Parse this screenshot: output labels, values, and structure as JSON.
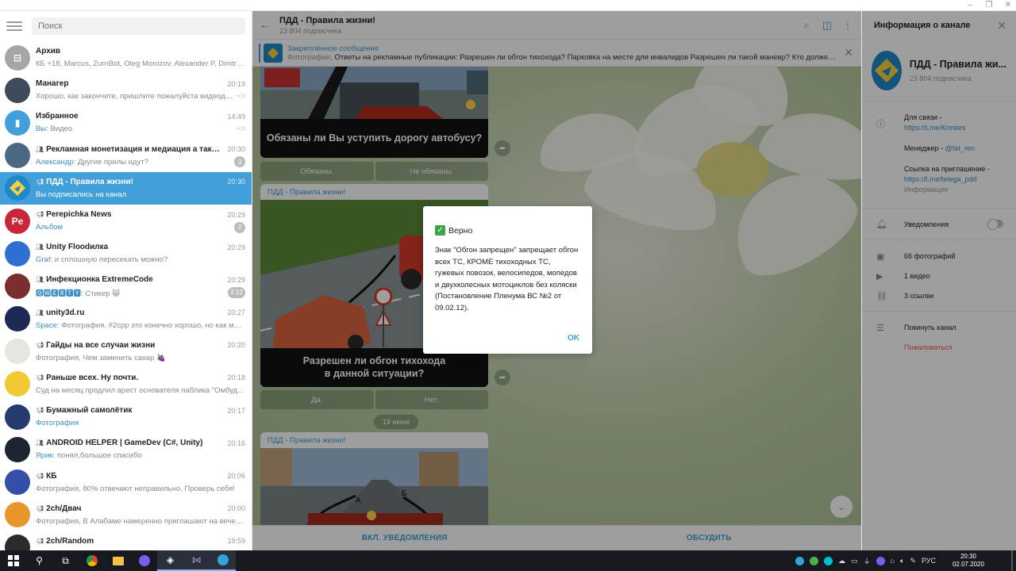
{
  "window": {
    "minimize": "–",
    "maximize": "❐",
    "close": "✕"
  },
  "search": {
    "placeholder": "Поиск"
  },
  "chats": [
    {
      "title": "Архив",
      "time": "",
      "preview_prefix": "",
      "preview": "КБ +18, Marcus, ZurnBot, Oleg Morozov, Alexander P, Dmitry Pogr...",
      "badge": "",
      "pinned": false,
      "type": "",
      "avatar_color": "#a6a6a6",
      "avatar_text": "⊟"
    },
    {
      "title": "Манагер",
      "time": "20:19",
      "preview_prefix": "",
      "preview": "Хорошо, как закончите, пришлите пожалуйста видеодем...",
      "badge": "",
      "pinned": true,
      "type": "",
      "avatar_color": "#3f4a5a",
      "avatar_text": ""
    },
    {
      "title": "Избранное",
      "time": "14:49",
      "preview_prefix": "Вы: ",
      "preview": "Видео",
      "badge": "",
      "pinned": true,
      "type": "",
      "avatar_color": "#419fd9",
      "avatar_text": "▮"
    },
    {
      "title": "Рекламная монетизация и медиация а также UA (...",
      "time": "20:30",
      "preview_prefix": "Александр: ",
      "preview": "Другие прилы идут?",
      "badge": "3",
      "pinned": false,
      "type": "group",
      "avatar_color": "#4c6782",
      "avatar_text": ""
    },
    {
      "title": "ПДД - Правила жизни!",
      "time": "20:30",
      "preview_prefix": "",
      "preview": "Вы подписались на канал",
      "badge": "",
      "pinned": false,
      "type": "channel",
      "avatar_color": "#1e88c9",
      "avatar_text": "",
      "active": true
    },
    {
      "title": "Perepichka News",
      "time": "20:29",
      "preview_prefix": "",
      "preview": "Альбом",
      "preview_link": true,
      "badge": "2",
      "pinned": false,
      "type": "channel",
      "avatar_color": "#c8273a",
      "avatar_text": "Pe"
    },
    {
      "title": "Unity Floodилка",
      "time": "20:29",
      "preview_prefix": "Graf: ",
      "preview": "и сплошную пересекать можно?",
      "badge": "",
      "pinned": false,
      "type": "group",
      "avatar_color": "#2f6fd1",
      "avatar_text": ""
    },
    {
      "title": "Инфекционка ExtremeCode",
      "time": "20:29",
      "preview_prefix": "🆀🆆🅴🆁🆃🆈: ",
      "preview": "Стикер 😸",
      "badge": "2.12",
      "pinned": false,
      "type": "group",
      "avatar_color": "#7b2e2e",
      "avatar_text": ""
    },
    {
      "title": "unity3d.ru",
      "time": "20:27",
      "preview_prefix": "Space: ",
      "preview": "Фотография, #2срр это конечно хорошо, но как мне те...",
      "badge": "",
      "pinned": false,
      "type": "group",
      "avatar_color": "#1b2a55",
      "avatar_text": ""
    },
    {
      "title": "Гайды на все случаи жизни",
      "time": "20:20",
      "preview_prefix": "",
      "preview": "Фотография, Чем заменить сахар 🍇",
      "badge": "",
      "pinned": false,
      "type": "channel",
      "avatar_color": "#e8e4e0",
      "avatar_text": ""
    },
    {
      "title": "Раньше всех. Ну почти.",
      "time": "20:18",
      "preview_prefix": "",
      "preview": "Суд на месяц продлил арест основателя паблика \"Омбудсмен ...",
      "badge": "",
      "pinned": false,
      "type": "channel",
      "avatar_color": "#f2c933",
      "avatar_text": ""
    },
    {
      "title": "Бумажный самолётик",
      "time": "20:17",
      "preview_prefix": "",
      "preview": "Фотография",
      "preview_link": true,
      "badge": "",
      "pinned": false,
      "type": "channel",
      "avatar_color": "#253a6e",
      "avatar_text": ""
    },
    {
      "title": "ANDROID HELPER | GameDev (C#, Unity)",
      "time": "20:16",
      "preview_prefix": "Ярик: ",
      "preview": "понял,большое спасибо",
      "badge": "",
      "pinned": false,
      "type": "group",
      "avatar_color": "#1d2630",
      "avatar_text": ""
    },
    {
      "title": "КБ",
      "time": "20:06",
      "preview_prefix": "",
      "preview": "Фотография, 80% отвечают неправильно. Проверь себя!",
      "badge": "",
      "pinned": false,
      "type": "channel",
      "avatar_color": "#3350a8",
      "avatar_text": ""
    },
    {
      "title": "2ch/Двач",
      "time": "20:00",
      "preview_prefix": "",
      "preview": "Фотография, В Алабаме намеренно приглашают на вечеринк...",
      "badge": "",
      "pinned": false,
      "type": "channel",
      "avatar_color": "#e8952a",
      "avatar_text": ""
    },
    {
      "title": "2ch/Random",
      "time": "19:59",
      "preview_prefix": "",
      "preview": "",
      "badge": "",
      "pinned": false,
      "type": "channel",
      "avatar_color": "#2b2b2b",
      "avatar_text": ""
    }
  ],
  "chat_header": {
    "title": "ПДД - Правила жизни!",
    "subtitle": "23 804 подписчика"
  },
  "pinned": {
    "label": "Закреплённое сообщение",
    "kind": "Фотография, ",
    "text": "Ответы на рекламные публикации:  Разрешен ли обгон тихохода?  Парковка на месте для инвалидов  Разрешен ли такой маневр?  Кто должен уступ..."
  },
  "messages": {
    "m1_caption": "Обязаны ли Вы уступить дорогу автобусу?",
    "m1_answers": [
      "Обязаны.",
      "Не обязаны."
    ],
    "m2_from": "ПДД - Правила жизни!",
    "m2_caption_l1": "Разрешен ли обгон тихохода",
    "m2_caption_l2": "в данной ситуации?",
    "m2_answers": [
      "Да.",
      "Нет."
    ],
    "date": "19 июня",
    "m3_from": "ПДД - Правила жизни!",
    "m3_labels": [
      "А",
      "Б"
    ]
  },
  "footer": {
    "left": "ВКЛ. УВЕДОМЛЕНИЯ",
    "right": "ОБСУДИТЬ"
  },
  "modal": {
    "title": "Верно",
    "text": "Знак \"Обгон запрещен\" запрещает обгон всех ТС, КРОМЕ тихоходных ТС, гужевых повозок, велосипедов, мопедов и двухколесных мотоциклов без коляски (Постановление Пленума ВС №2 от 09.02.12).",
    "ok": "OK"
  },
  "info": {
    "header": "Информация о канале",
    "name": "ПДД - Правила жи...",
    "subs": "23 804 подписчика",
    "contact_label": "Для связи -",
    "contact_link": "https://t.me/Krestes",
    "manager_label": "Менеджер - ",
    "manager_link": "@fat_ren",
    "invite_label": "Ссылка на приглашение -",
    "invite_link": "https://t.me/telega_pdd",
    "info_caption": "Информация",
    "notifications": "Уведомления",
    "notifications_on": false,
    "photos": "66 фотографий",
    "videos": "1 видео",
    "links": "3 ссылки",
    "leave": "Покинуть канал",
    "report": "Пожаловаться"
  },
  "taskbar": {
    "lang": "РУС",
    "time": "20:30",
    "date": "02.07.2020"
  },
  "colors": {
    "accent": "#419fd9",
    "danger": "#e05c5c",
    "success": "#3aa64a"
  }
}
